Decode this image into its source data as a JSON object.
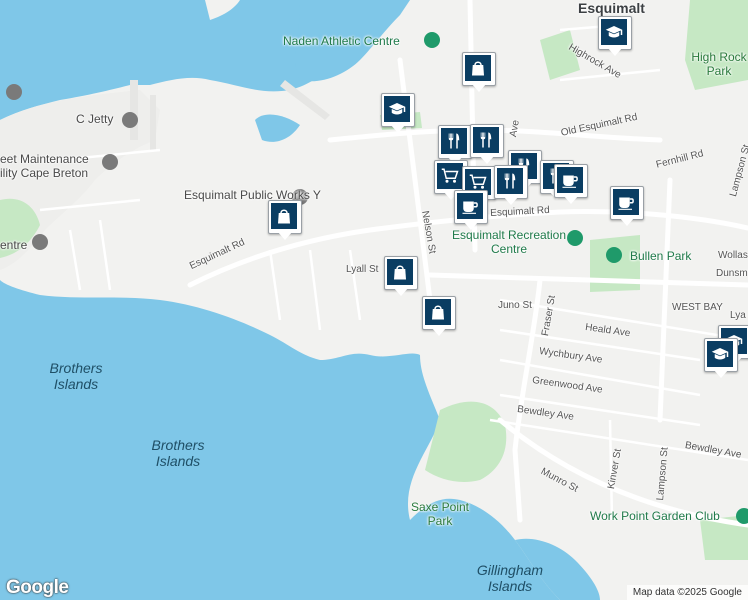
{
  "map": {
    "place_labels": [
      {
        "name": "esquimalt-label",
        "text": "Esquimalt",
        "cls": "big"
      },
      {
        "name": "high-rock-park-label",
        "text": "High Rock Park",
        "cls": "park"
      },
      {
        "name": "naden-athletic-centre-label",
        "text": "Naden Athletic Centre",
        "cls": "poi-green"
      },
      {
        "name": "c-jetty-label",
        "text": "C Jetty",
        "cls": "poi"
      },
      {
        "name": "fleet-maintenance-label",
        "text": "eet Maintenance",
        "cls": "poi"
      },
      {
        "name": "facility-cape-breton-label",
        "text": "ility Cape Breton",
        "cls": "poi"
      },
      {
        "name": "esquimalt-public-works-label",
        "text": "Esquimalt Public Works Y",
        "cls": "poi"
      },
      {
        "name": "centre-label",
        "text": "entre",
        "cls": "poi"
      },
      {
        "name": "esquimalt-recreation-centre-label",
        "text": "Esquimalt Recreation Centre",
        "cls": "poi-green"
      },
      {
        "name": "bullen-park-label",
        "text": "Bullen Park",
        "cls": "poi-green"
      },
      {
        "name": "west-bay-label",
        "text": "WEST BAY",
        "cls": "street"
      },
      {
        "name": "saxe-point-park-label",
        "text": "Saxe Point Park",
        "cls": "park"
      },
      {
        "name": "work-point-garden-club-label",
        "text": "Work Point Garden Club",
        "cls": "poi-green"
      },
      {
        "name": "brothers-islands-label-1",
        "text": "Brothers Islands",
        "cls": "water"
      },
      {
        "name": "brothers-islands-label-2",
        "text": "Brothers Islands",
        "cls": "water"
      },
      {
        "name": "gillingham-islands-label",
        "text": "Gillingham Islands",
        "cls": "water"
      }
    ],
    "street_labels": [
      {
        "name": "highrock-ave-label",
        "text": "Highrock Ave"
      },
      {
        "name": "old-esquimalt-rd-label",
        "text": "Old Esquimalt Rd"
      },
      {
        "name": "fernhill-rd-label",
        "text": "Fernhill Rd"
      },
      {
        "name": "lampson-st-label-top",
        "text": "Lampson St"
      },
      {
        "name": "esquimalt-rd-label",
        "text": "Esquimalt Rd"
      },
      {
        "name": "esquimalt-rd-label-west",
        "text": "Esquimalt Rd"
      },
      {
        "name": "nelson-st-label",
        "text": "Nelson St"
      },
      {
        "name": "lyall-st-label",
        "text": "Lyall St"
      },
      {
        "name": "juno-st-label",
        "text": "Juno St"
      },
      {
        "name": "fraser-st-label",
        "text": "Fraser St"
      },
      {
        "name": "heald-ave-label",
        "text": "Heald Ave"
      },
      {
        "name": "wychbury-ave-label",
        "text": "Wychbury Ave"
      },
      {
        "name": "greenwood-ave-label",
        "text": "Greenwood Ave"
      },
      {
        "name": "bewdley-ave-label",
        "text": "Bewdley Ave"
      },
      {
        "name": "bewdley-ave-label-east",
        "text": "Bewdley Ave"
      },
      {
        "name": "kinver-st-label",
        "text": "Kinver St"
      },
      {
        "name": "lampson-st-label",
        "text": "Lampson St"
      },
      {
        "name": "munro-st-label",
        "text": "Munro St"
      },
      {
        "name": "wollas-label",
        "text": "Wollas"
      },
      {
        "name": "dunsmi-label",
        "text": "Dunsmi"
      },
      {
        "name": "lya-label",
        "text": "Lya"
      },
      {
        "name": "ave-label",
        "text": "Ave"
      }
    ],
    "markers": [
      {
        "name": "school-marker-top",
        "icon": "graduation-cap-icon"
      },
      {
        "name": "shopping-marker-top",
        "icon": "shopping-bag-icon"
      },
      {
        "name": "school-marker-naden",
        "icon": "graduation-cap-icon"
      },
      {
        "name": "restaurant-marker-1",
        "icon": "fork-knife-icon"
      },
      {
        "name": "restaurant-marker-2",
        "icon": "fork-knife-icon"
      },
      {
        "name": "restaurant-marker-3",
        "icon": "fork-knife-icon"
      },
      {
        "name": "grocery-marker-1",
        "icon": "shopping-cart-icon"
      },
      {
        "name": "grocery-marker-2",
        "icon": "shopping-cart-icon"
      },
      {
        "name": "restaurant-marker-4",
        "icon": "fork-knife-icon"
      },
      {
        "name": "restaurant-marker-5",
        "icon": "fork-knife-icon"
      },
      {
        "name": "cafe-marker-1",
        "icon": "coffee-cup-icon"
      },
      {
        "name": "cafe-marker-2",
        "icon": "coffee-cup-icon"
      },
      {
        "name": "cafe-marker-3",
        "icon": "coffee-cup-icon"
      },
      {
        "name": "shopping-marker-publicworks",
        "icon": "shopping-bag-icon"
      },
      {
        "name": "shopping-marker-lyall",
        "icon": "shopping-bag-icon"
      },
      {
        "name": "shopping-marker-juno",
        "icon": "shopping-bag-icon"
      },
      {
        "name": "school-marker-right-1",
        "icon": "graduation-cap-icon"
      },
      {
        "name": "school-marker-right-2",
        "icon": "graduation-cap-icon"
      }
    ],
    "attribution": "Map data ©2025 Google",
    "logo": "Google",
    "colors": {
      "water": "#7fc7e8",
      "land": "#f2f2f0",
      "park": "#c6e8c4",
      "marker": "#0a3d62",
      "road": "#ffffff"
    }
  }
}
